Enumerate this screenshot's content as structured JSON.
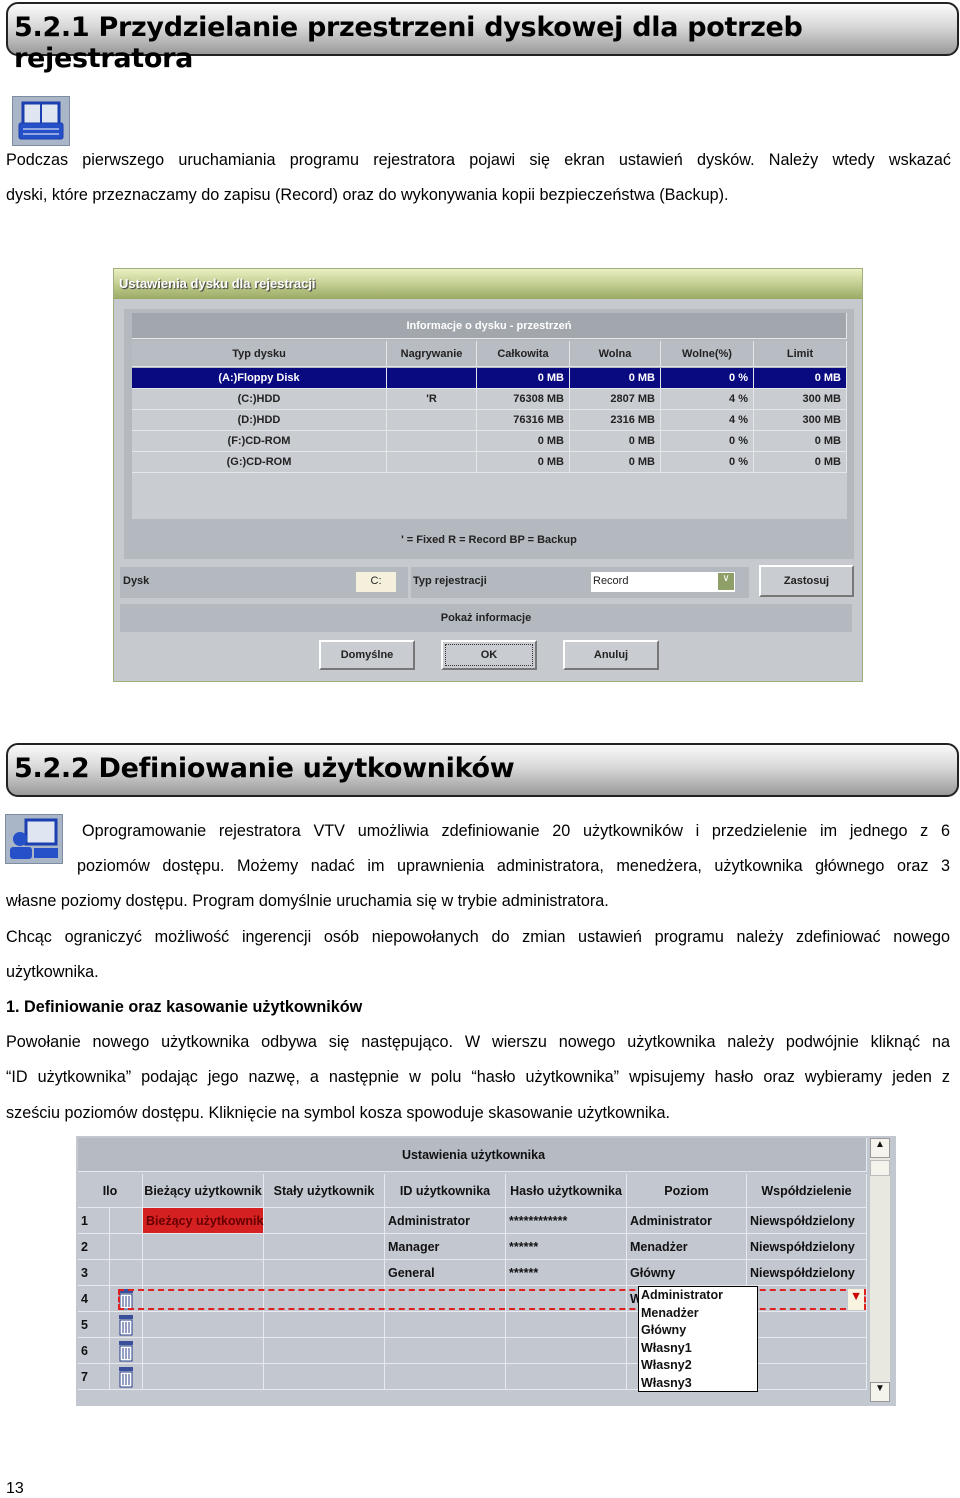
{
  "section1": {
    "heading": "5.2.1 Przydzielanie przestrzeni dyskowej dla potrzeb rejestratora",
    "icon": "book-printer-icon",
    "para": [
      "Podczas pierwszego uruchamiania programu rejestratora pojawi się ekran ustawień dysków. Należy wtedy wskazać",
      "dyski, które przeznaczamy do zapisu (Record) oraz do wykonywania kopii bezpieczeństwa (Backup)."
    ]
  },
  "dialog1": {
    "title": "Ustawienia dysku dla rejestracji",
    "panel_title": "Informacje o dysku - przestrzeń",
    "columns": [
      "Typ dysku",
      "Nagrywanie",
      "Całkowita",
      "Wolna",
      "Wolne(%)",
      "Limit"
    ],
    "rows": [
      [
        "(A:)Floppy Disk",
        "",
        "0 MB",
        "0 MB",
        "0 %",
        "0 MB"
      ],
      [
        "(C:)HDD",
        "'R",
        "76308 MB",
        "2807 MB",
        "4 %",
        "300 MB"
      ],
      [
        "(D:)HDD",
        "",
        "76316 MB",
        "2316 MB",
        "4 %",
        "300 MB"
      ],
      [
        "(F:)CD-ROM",
        "",
        "0 MB",
        "0 MB",
        "0 %",
        "0 MB"
      ],
      [
        "(G:)CD-ROM",
        "",
        "0 MB",
        "0 MB",
        "0 %",
        "0 MB"
      ]
    ],
    "selected_row": 0,
    "legend": "' = Fixed     R = Record     BP = Backup",
    "disk_label": "Dysk",
    "disk_value": "C:",
    "type_label": "Typ rejestracji",
    "type_value": "Record",
    "apply": "Zastosuj",
    "show_info": "Pokaż informacje",
    "defaults": "Domyślne",
    "ok": "OK",
    "cancel": "Anuluj",
    "colors": {
      "selected": "#0a0a80",
      "title": "#9aab64"
    }
  },
  "section2": {
    "heading": "5.2.2 Definiowanie użytkowników",
    "icon": "user-computer-icon",
    "para": [
      "Oprogramowanie rejestratora VTV umożliwia zdefiniowanie 20 użytkowników i przedzielenie im jednego z 6",
      "poziomów dostępu. Możemy nadać im uprawnienia administratora, menedżera, użytkownika głównego oraz 3",
      "własne poziomy dostępu. Program domyślnie uruchamia się w trybie administratora.",
      "Chcąc ograniczyć możliwość ingerencji osób niepowołanych do zmian ustawień programu należy zdefiniować nowego",
      "użytkownika."
    ],
    "subheading": "1. Definiowanie oraz kasowanie użytkowników",
    "para2": [
      "Powołanie nowego użytkownika odbywa się następująco. W wierszu nowego użytkownika należy podwójnie kliknąć na",
      "“ID użytkownika” podając jego nazwę, a następnie w polu “hasło użytkownika” wpisujemy hasło oraz wybieramy jeden z",
      "sześciu poziomów dostępu. Kliknięcie na symbol kosza spowoduje skasowanie użytkownika."
    ]
  },
  "table2": {
    "title": "Ustawienia użytkownika",
    "columns": [
      "Ilo",
      "Bieżący użytkownik",
      "Stały użytkownik",
      "ID użytkownika",
      "Hasło użytkownika",
      "Poziom",
      "Współdzielenie"
    ],
    "rows": [
      [
        "1",
        "Bieżący użytkownik",
        "",
        "Administrator",
        "************",
        "Administrator",
        "Niewspółdzielony"
      ],
      [
        "2",
        "",
        "",
        "Manager",
        "******",
        "Menadżer",
        "Niewspółdzielony"
      ],
      [
        "3",
        "",
        "",
        "General",
        "******",
        "Główny",
        "Niewspółdzielony"
      ],
      [
        "4",
        "",
        "",
        "",
        "",
        "W",
        ""
      ],
      [
        "5",
        "",
        "",
        "",
        "",
        "",
        ""
      ],
      [
        "6",
        "",
        "",
        "",
        "",
        "",
        ""
      ],
      [
        "7",
        "",
        "",
        "",
        "",
        "",
        ""
      ]
    ],
    "dropdown_options": [
      "Administrator",
      "Menadżer",
      "Główny",
      "Własny1",
      "Własny2",
      "Własny3"
    ],
    "colors": {
      "current_user": "#d42020",
      "dashed": "#e02020"
    }
  },
  "page_number": "13"
}
